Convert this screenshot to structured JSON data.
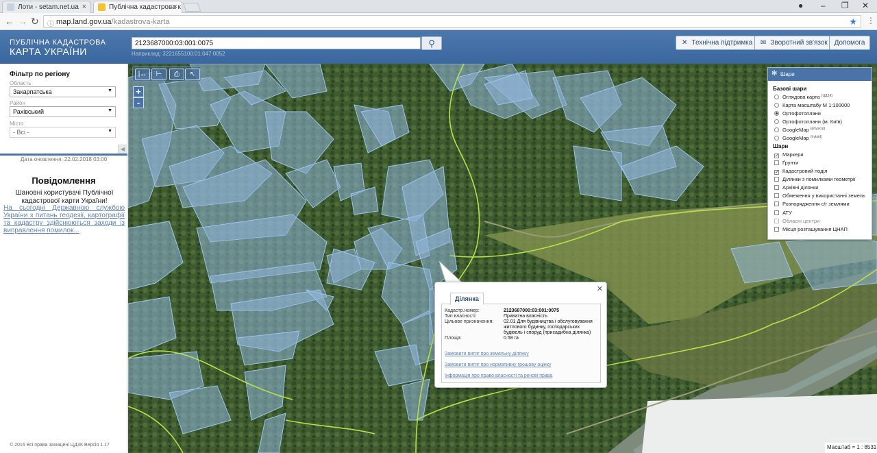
{
  "browser": {
    "tabs": [
      {
        "title": "Лоти - setam.net.ua",
        "active": false
      },
      {
        "title": "Публічна кадастрова к",
        "active": true
      }
    ],
    "url_host": "map.land.gov.ua",
    "url_path": "/kadastrova-karta"
  },
  "header": {
    "brand_line1": "ПУБЛІЧНА КАДАСТРОВА",
    "brand_line2": "КАРТА УКРАЇНИ",
    "search_value": "2123687000:03:001:0075",
    "search_example": "Наприклад: 3221655100:01:047:0052",
    "buttons": {
      "support": "Технічна підтримка",
      "feedback": "Зворотний зв'язок",
      "help": "Допомога"
    }
  },
  "sidebar": {
    "filter_title": "Фільтр по регіону",
    "region_label": "Область",
    "region_value": "Закарпатська",
    "district_label": "Район",
    "district_value": "Рахівський",
    "city_label": "Місто",
    "city_value": "- Всі -",
    "updated": "Дата оновлення: 22.02.2018 03:00",
    "notice_title": "Повідомлення",
    "notice_body": "Шановні користувачі Публічної кадастрової карти України!",
    "notice_link": "На сьогодні Державною службою України з питань геодезії, картографії та кадастру здійснюються заходи із виправлення помилок...",
    "copyright": "© 2016 Всі права захищені  ЦДЗК  Версія 1.17"
  },
  "layers": {
    "title": "Шари",
    "base_title": "Базові шари",
    "base": [
      {
        "label": "Оглядова карта",
        "sup": "(ЦДЗК)",
        "selected": false
      },
      {
        "label": "Карта масштабу М 1:100000",
        "sup": "",
        "selected": false
      },
      {
        "label": "Ортофотоплани",
        "sup": "",
        "selected": true
      },
      {
        "label": "Ортофотоплани (м. Київ)",
        "sup": "",
        "selected": false
      },
      {
        "label": "GoogleMap",
        "sup": "(physical)",
        "selected": false
      },
      {
        "label": "GoogleMap",
        "sup": "(hybrid)",
        "selected": false
      }
    ],
    "overlay_title": "Шари",
    "overlays": [
      {
        "label": "Маркери",
        "checked": true,
        "disabled": false
      },
      {
        "label": "Ґрунти",
        "checked": false,
        "disabled": false
      },
      {
        "label": "Кадастровий поділ",
        "checked": true,
        "disabled": false
      },
      {
        "label": "Ділянки з помилками геометрії",
        "checked": false,
        "disabled": false
      },
      {
        "label": "Архівні ділянки",
        "checked": false,
        "disabled": false
      },
      {
        "label": "Обмеження у використанні земель",
        "checked": false,
        "disabled": false
      },
      {
        "label": "Розпорядження с/г землями",
        "checked": false,
        "disabled": false
      },
      {
        "label": "АТУ",
        "checked": false,
        "disabled": false
      },
      {
        "label": "Обласні центри",
        "checked": false,
        "disabled": true
      },
      {
        "label": "Місця розташування ЦНАП",
        "checked": false,
        "disabled": false
      }
    ]
  },
  "popup": {
    "tab": "Ділянка",
    "rows": [
      {
        "key": "Кадастр.номер:",
        "value": "2123687000:03:001:0075"
      },
      {
        "key": "Тип власності:",
        "value": "Приватна власність"
      },
      {
        "key": "Цільове призначення:",
        "value": "02.01 Для будівництва і обслуговування житлового будинку, господарських будівель і споруд (присадибна ділянка)"
      },
      {
        "key": "Площа:",
        "value": "0.58 га"
      }
    ],
    "links": [
      "Замовити витяг про земельну ділянку",
      "Замовити витяг про нормативну грошову оцінку",
      "Інформація про право власності та речові права"
    ]
  },
  "map": {
    "zoom_in": "+",
    "zoom_out": "-",
    "scale": "Масштаб = 1 : 8531"
  },
  "colors": {
    "header": "#3f6ca3",
    "parcel_fill": "#8fb4d8",
    "parcel_stroke": "#9cc4ee",
    "boundary": "#b8e04a",
    "link": "#5f83b5"
  }
}
